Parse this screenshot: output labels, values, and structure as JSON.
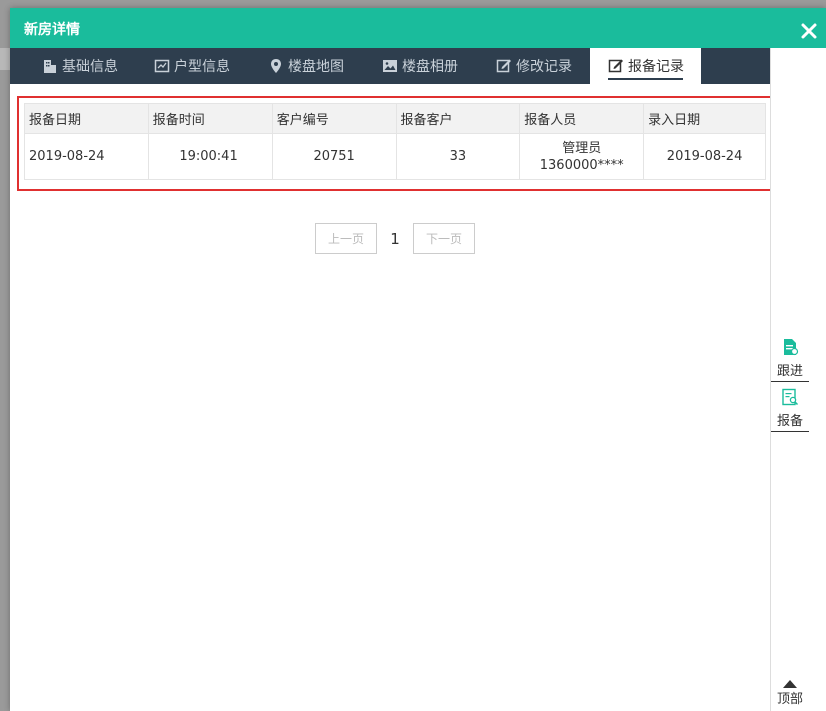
{
  "dialog": {
    "title": "新房详情",
    "close_icon": "close-icon"
  },
  "tabs": [
    {
      "label": "基础信息",
      "icon": "building-icon"
    },
    {
      "label": "户型信息",
      "icon": "floorplan-icon"
    },
    {
      "label": "楼盘地图",
      "icon": "map-pin-icon"
    },
    {
      "label": "楼盘相册",
      "icon": "image-icon"
    },
    {
      "label": "修改记录",
      "icon": "edit-icon"
    },
    {
      "label": "报备记录",
      "icon": "edit-icon",
      "active": true
    }
  ],
  "table": {
    "headers": [
      "报备日期",
      "报备时间",
      "客户编号",
      "报备客户",
      "报备人员",
      "录入日期"
    ],
    "rows": [
      {
        "date": "2019-08-24",
        "time": "19:00:41",
        "customer_no": "20751",
        "customer": "33",
        "staff_name": "管理员",
        "staff_phone": "1360000****",
        "entry_date": "2019-08-24"
      }
    ]
  },
  "pager": {
    "prev": "上一页",
    "current": "1",
    "next": "下一页"
  },
  "sidebar": {
    "follow_label": "跟进",
    "report_label": "报备",
    "top_label": "顶部"
  },
  "colors": {
    "accent": "#1abc9c",
    "tabbar": "#2e3e4e",
    "highlight": "#e03030"
  }
}
